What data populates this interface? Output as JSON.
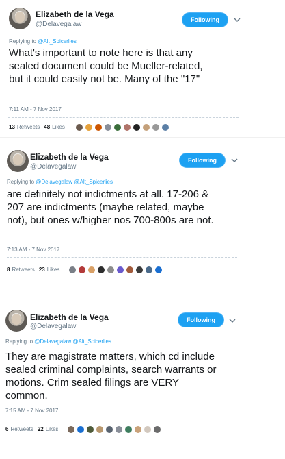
{
  "tweets": [
    {
      "name": "Elizabeth de la Vega",
      "handle": "@Delavegalaw",
      "follow_label": "Following",
      "reply_prefix": "Replying to",
      "reply_to": "@Alt_Spicerlies",
      "lines": [
        "What's important to note here is that any",
        "sealed document could be Mueller-related,",
        "but it could easily not be. Many of the \"17\""
      ],
      "timestamp": "7:11 AM - 7 Nov 2017",
      "retweets": "13",
      "retweets_label": "Retweets",
      "likes": "48",
      "likes_label": "Likes",
      "liker_colors": [
        "#6b5a4e",
        "#e6a23c",
        "#cc5500",
        "#8a8f99",
        "#3b6e3b",
        "#b0746a",
        "#222222",
        "#c4a07a",
        "#999999",
        "#5b7fa6"
      ]
    },
    {
      "name": "Elizabeth de la Vega",
      "handle": "@Delavegalaw",
      "follow_label": "Following",
      "reply_prefix": "Replying to",
      "reply_to": "@Delavegalaw @Alt_Spicerlies",
      "lines": [
        "are definitely not indictments at all. 17-206 &",
        "207 are indictments (maybe related, maybe",
        "not), but ones w/higher nos 700-800s are not."
      ],
      "timestamp": "7:13 AM - 7 Nov 2017",
      "retweets": "8",
      "retweets_label": "Retweets",
      "likes": "23",
      "likes_label": "Likes",
      "liker_colors": [
        "#7a7f87",
        "#b33a3a",
        "#d9a066",
        "#2e2e2e",
        "#8c8c8c",
        "#6a5acd",
        "#a35b3c",
        "#3b3b3b",
        "#4a6a8a",
        "#1a6fd1"
      ]
    },
    {
      "name": "Elizabeth de la Vega",
      "handle": "@Delavegalaw",
      "follow_label": "Following",
      "reply_prefix": "Replying to",
      "reply_to": "@Delavegalaw @Alt_Spicerlies",
      "lines": [
        "They are magistrate matters, which cd include",
        "sealed criminal complaints, search warrants or",
        "motions. Crim sealed filings are VERY",
        "common."
      ],
      "timestamp": "7:15 AM - 7 Nov 2017",
      "retweets": "6",
      "retweets_label": "Retweets",
      "likes": "22",
      "likes_label": "Likes",
      "liker_colors": [
        "#7b6a5c",
        "#1a6fd1",
        "#4f5b3a",
        "#b8986f",
        "#5a6470",
        "#8a8f99",
        "#3e7d5e",
        "#c9a27a",
        "#d2c8be",
        "#6b6b6b"
      ]
    }
  ],
  "colors": {
    "accent": "#1da1f2",
    "text": "#14171a",
    "muted": "#657786"
  }
}
